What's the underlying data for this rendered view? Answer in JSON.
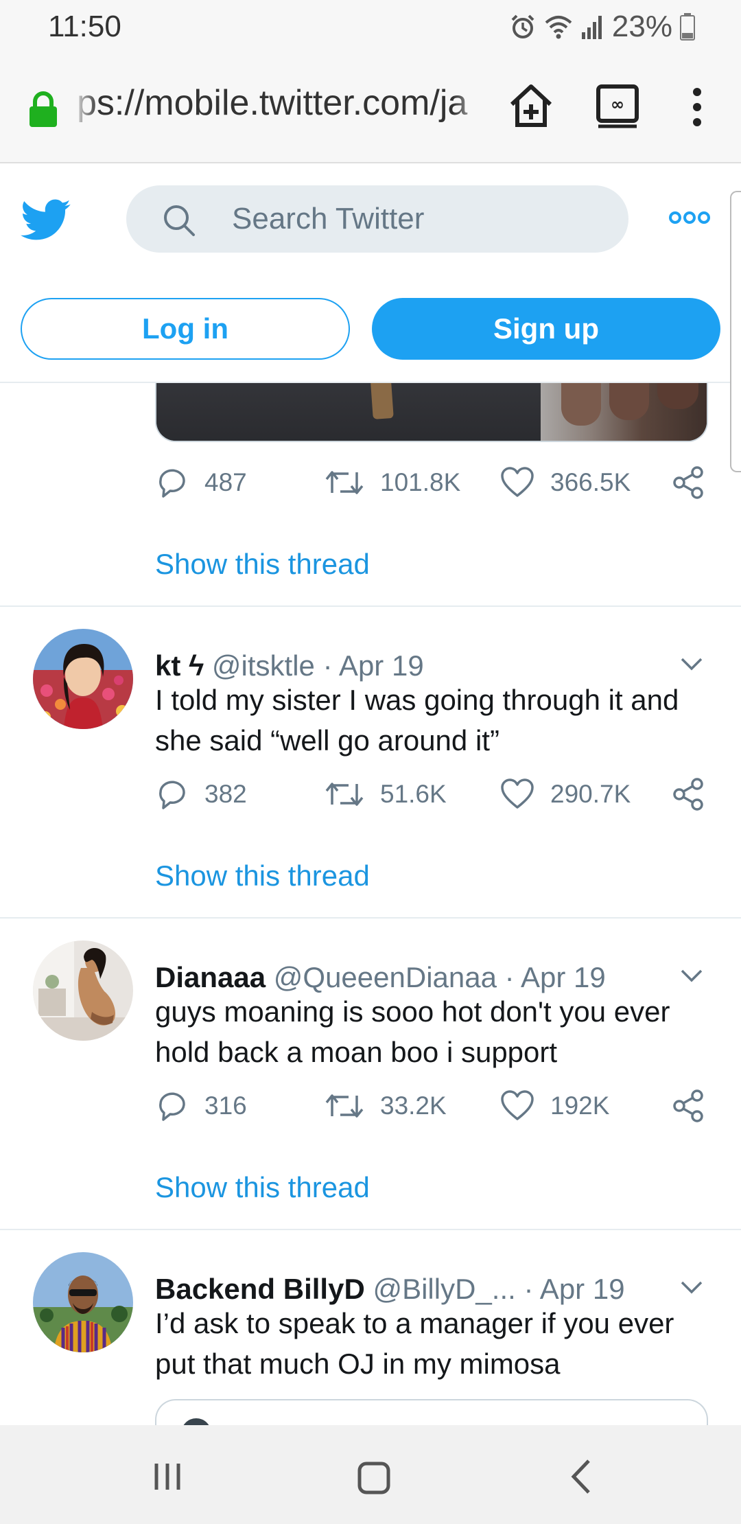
{
  "status_bar": {
    "time": "11:50",
    "battery": "23%",
    "icons": [
      "alarm-icon",
      "wifi-icon",
      "signal-icon",
      "battery-icon"
    ]
  },
  "browser": {
    "url": "ps://mobile.twitter.com/ja",
    "icons": [
      "lock-icon",
      "home-plus-icon",
      "tabs-icon",
      "menu-icon"
    ]
  },
  "header": {
    "search_placeholder": "Search Twitter",
    "login_label": "Log in",
    "signup_label": "Sign up"
  },
  "colors": {
    "brand": "#1da1f2",
    "link": "#1b95e0",
    "secondary_text": "#657786"
  },
  "feed": {
    "first_tweet": {
      "replies": "487",
      "retweets": "101.8K",
      "likes": "366.5K",
      "thread_link": "Show this thread"
    },
    "tweets": [
      {
        "name": "kt ϟ",
        "handle": "@itsktle",
        "date": "· Apr 19",
        "text": "I told my sister I was going through it and she said “well go around it”",
        "replies": "382",
        "retweets": "51.6K",
        "likes": "290.7K",
        "thread_link": "Show this thread"
      },
      {
        "name": "Dianaaa",
        "handle": "@QueeenDianaa",
        "date": "· Apr 19",
        "text": "guys moaning is sooo hot don't you ever hold back a moan boo i support",
        "replies": "316",
        "retweets": "33.2K",
        "likes": "192K",
        "thread_link": "Show this thread"
      },
      {
        "name": "Backend BillyD",
        "handle": "@BillyD_...",
        "date": "· Apr 19",
        "text": "I’d ask to speak to a manager if you ever put that much OJ in my mimosa"
      }
    ]
  }
}
